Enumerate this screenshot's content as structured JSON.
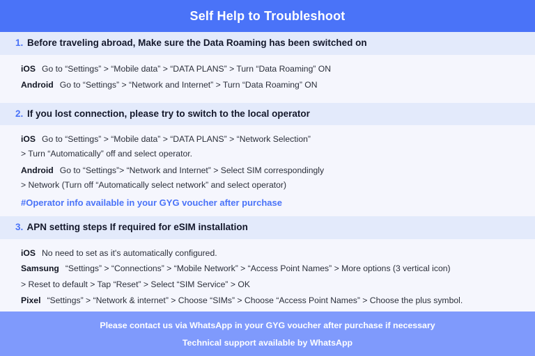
{
  "header": {
    "title": "Self Help to Troubleshoot"
  },
  "sections": [
    {
      "number": "1.",
      "heading_lead": "Before traveling abroad,",
      "heading_rest": " Make sure the Data Roaming has been switched on",
      "lines": [
        {
          "platform": "iOS",
          "text": "Go to “Settings” > “Mobile data” > “DATA PLANS” > Turn “Data Roaming” ON"
        },
        {
          "platform": "Android",
          "text": "Go to “Settings” > “Network and Internet” > Turn “Data Roaming” ON"
        }
      ],
      "note": ""
    },
    {
      "number": "2.",
      "heading_lead": "If you lost connection, please try to switch to the local operator",
      "heading_rest": "",
      "lines": [
        {
          "platform": "iOS",
          "text": "Go to “Settings” > “Mobile data” > “DATA PLANS” > “Network Selection”"
        },
        {
          "platform": "",
          "text": "> Turn “Automatically” off and select operator."
        },
        {
          "platform": "Android",
          "text": "Go to “Settings”>  “Network and Internet” > Select SIM correspondingly"
        },
        {
          "platform": "",
          "text": "> Network (Turn off “Automatically select network” and select operator)"
        }
      ],
      "note": "#Operator info available in your GYG voucher after purchase"
    },
    {
      "number": "3.",
      "heading_lead": "APN setting steps If required for eSIM installation",
      "heading_rest": "",
      "lines": [
        {
          "platform": "iOS",
          "text": "No need to set as it's automatically configured."
        },
        {
          "platform": "Samsung",
          "text": "“Settings” > “Connections” > “Mobile Network” > “Access Point Names” > More options (3 vertical icon)"
        },
        {
          "platform": "",
          "text": "> Reset to default > Tap “Reset” > Select “SIM Service” > OK"
        },
        {
          "platform": "Pixel",
          "text": "“Settings” > “Network & internet” > Choose “SIMs” > Choose “Access Point Names” > Choose the plus symbol."
        }
      ],
      "note": ""
    }
  ],
  "footer": {
    "line1": "Please contact us via WhatsApp  in your GYG voucher after purchase if necessary",
    "line2": "Technical support available by WhatsApp"
  },
  "colors": {
    "header_blue": "#4a73f8",
    "footer_blue": "#7f9afc",
    "band_blue": "#e3eafb",
    "page_bg": "#f5f6fd",
    "accent": "#4a73f8",
    "text_dark": "#14182b"
  }
}
